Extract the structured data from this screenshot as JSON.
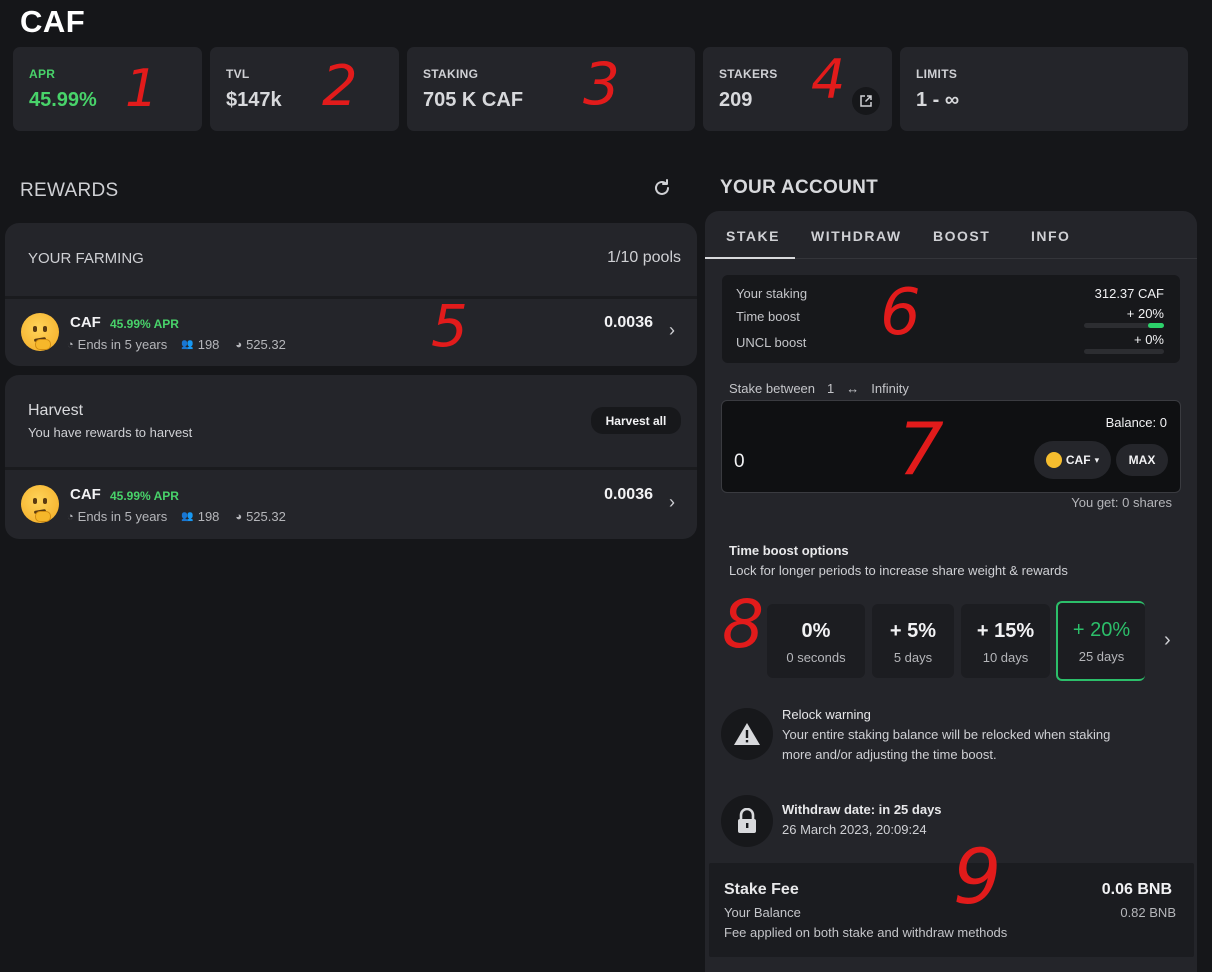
{
  "header": {
    "title": "CAF"
  },
  "stats": [
    {
      "label": "APR",
      "value": "45.99%"
    },
    {
      "label": "TVL",
      "value": "$147k"
    },
    {
      "label": "STAKING",
      "value": "705 K CAF"
    },
    {
      "label": "STAKERS",
      "value": "209"
    },
    {
      "label": "LIMITS",
      "value": "1 - ∞"
    }
  ],
  "annotations": [
    "1",
    "2",
    "3",
    "4",
    "5",
    "6",
    "7",
    "8",
    "9"
  ],
  "rewards": {
    "title": "REWARDS",
    "farming_title": "YOUR FARMING",
    "pools_count": "1/10 pools",
    "pools": [
      {
        "name": "CAF",
        "apr": "45.99% APR",
        "ends": "Ends in 5 years",
        "users": "198",
        "stake": "525.32",
        "amount": "0.0036"
      },
      {
        "name": "CAF",
        "apr": "45.99% APR",
        "ends": "Ends in 5 years",
        "users": "198",
        "stake": "525.32",
        "amount": "0.0036"
      }
    ],
    "harvest_title": "Harvest",
    "harvest_sub": "You have rewards to harvest",
    "harvest_button": "Harvest all"
  },
  "account": {
    "title": "YOUR ACCOUNT",
    "tabs": [
      "STAKE",
      "WITHDRAW",
      "BOOST",
      "INFO"
    ],
    "active_tab": "STAKE",
    "your_staking_label": "Your staking",
    "your_staking_value": "312.37 CAF",
    "time_boost_label": "Time boost",
    "time_boost_value": "+ 20%",
    "time_boost_level": 0.2,
    "uncl_boost_label": "UNCL boost",
    "uncl_boost_value": "+ 0%",
    "uncl_boost_level": 0.0,
    "stake_between_label": "Stake between",
    "stake_min": "1",
    "stake_arrow": "↔",
    "stake_max": "Infinity",
    "balance_label": "Balance: 0",
    "amount_value": "0",
    "token_label": "CAF",
    "max_button": "MAX",
    "you_get": "You get: 0 shares",
    "boost_title": "Time boost options",
    "boost_sub": "Lock for longer periods to increase share weight & rewards",
    "boost_options": [
      {
        "pct": "0%",
        "dur": "0 seconds"
      },
      {
        "pct": "+ 5%",
        "dur": "5 days"
      },
      {
        "pct": "+ 15%",
        "dur": "10 days"
      },
      {
        "pct": "+ 20%",
        "dur": "25 days"
      }
    ],
    "relock_title": "Relock warning",
    "relock_line1": "Your entire staking balance will be relocked when staking",
    "relock_line2": "more and/or adjusting the time boost.",
    "withdraw_title": "Withdraw date: in 25 days",
    "withdraw_date": "26 March 2023, 20:09:24",
    "fee_title": "Stake Fee",
    "fee_value": "0.06 BNB",
    "your_balance_label": "Your Balance",
    "your_balance_value": "0.82 BNB",
    "fee_note": "Fee applied on both stake and withdraw methods"
  },
  "colors": {
    "accent_green": "#48d36a",
    "annotation_red": "#e21b1b",
    "card_bg": "#24252a",
    "page_bg": "#151619"
  }
}
